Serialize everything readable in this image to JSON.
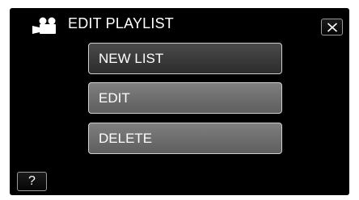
{
  "header": {
    "title": "EDIT PLAYLIST",
    "mode_icon": "video-camera-icon",
    "close_icon": "close-x-icon"
  },
  "menu": {
    "items": [
      {
        "label": "NEW LIST",
        "state": "selected"
      },
      {
        "label": "EDIT",
        "state": "normal"
      },
      {
        "label": "DELETE",
        "state": "normal"
      }
    ]
  },
  "footer": {
    "help_label": "?"
  },
  "colors": {
    "screen_background": "#000000",
    "button_border": "#cfcfcf",
    "button_selected": "#2c2c2c",
    "button_normal": "#6e6e6e",
    "text": "#ffffff"
  }
}
